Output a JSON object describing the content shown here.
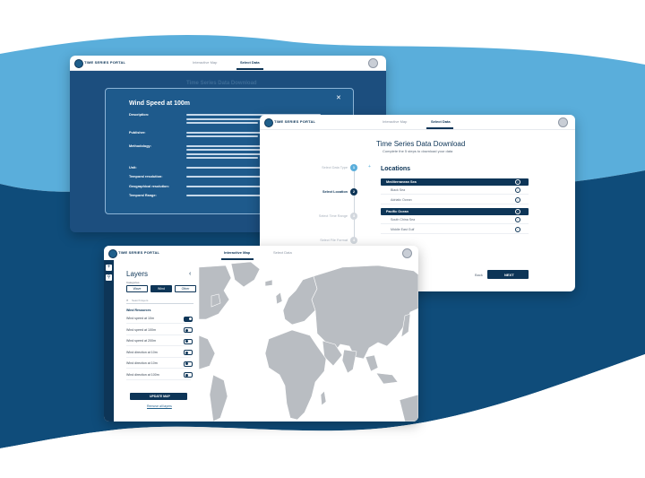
{
  "colors": {
    "navy": "#0d3557",
    "light_blue": "#5aaedb",
    "dark_blue": "#0f4c7a"
  },
  "common": {
    "app_name": "TIME SERIES PORTAL",
    "tab_map": "Interactive Map",
    "tab_data": "Select Data"
  },
  "modal": {
    "title": "Wind Speed at 100m",
    "bg_heading": "Time Series Data Download",
    "rows": [
      {
        "label": "Description:",
        "lines": 3
      },
      {
        "label": "Publisher:",
        "lines": 2
      },
      {
        "label": "Methodology:",
        "lines": 4
      },
      {
        "label": "Unit:",
        "lines": 1
      },
      {
        "label": "Temporal resolution:",
        "lines": 1
      },
      {
        "label": "Geographical resolution:",
        "lines": 1
      },
      {
        "label": "Temporal Range:",
        "lines": 1
      }
    ]
  },
  "download": {
    "title": "Time Series Data Download",
    "subtitle": "Complete the 5 steps to download your data",
    "steps": [
      {
        "label": "Select Data Type",
        "num": "1",
        "state": "done"
      },
      {
        "label": "Select Location",
        "num": "2",
        "state": "active"
      },
      {
        "label": "Select Time Range",
        "num": "3",
        "state": "todo"
      },
      {
        "label": "Select File Format",
        "num": "4",
        "state": "todo"
      }
    ],
    "locations_title": "Locations",
    "groups": [
      {
        "name": "Mediterranean Sea",
        "items": [
          "Black Sea",
          "Adriatic Ocean"
        ]
      },
      {
        "name": "Pacific Ocean",
        "items": [
          "South China Sea",
          "Middle East Gulf"
        ]
      }
    ],
    "back": "Back",
    "next": "NEXT"
  },
  "layers": {
    "title": "Layers",
    "categories_label": "Categories",
    "categories": [
      "Wave",
      "Wind",
      "Other"
    ],
    "active_category": "Wind",
    "search_placeholder": "Search layers",
    "section": "Wind Resources",
    "items": [
      "Wind speed at 10m",
      "Wind speed at 100m",
      "Wind speed at 200m",
      "Wind direction at 10m",
      "Wind direction at 10m",
      "Wind direction at 100m"
    ],
    "update": "UPDATE MAP",
    "remove": "Remove all layers"
  }
}
